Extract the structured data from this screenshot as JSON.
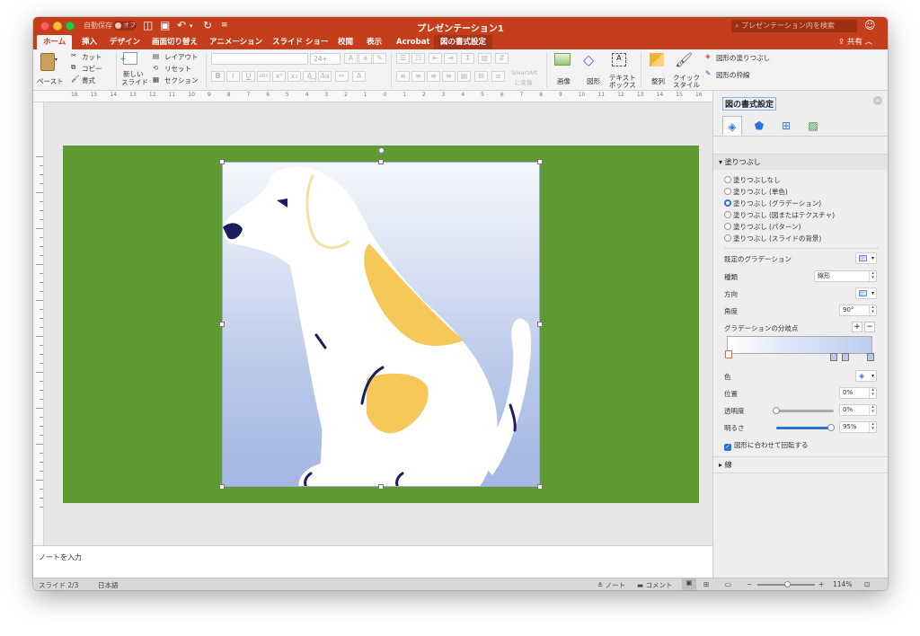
{
  "titlebar": {
    "autosave_label": "自動保存",
    "autosave_state": "オフ",
    "doc_title": "プレゼンテーション1",
    "search_placeholder": "プレゼンテーション内を検索"
  },
  "tabs": [
    {
      "label": "ホーム"
    },
    {
      "label": "挿入"
    },
    {
      "label": "デザイン"
    },
    {
      "label": "画面切り替え"
    },
    {
      "label": "アニメーション"
    },
    {
      "label": "スライド ショー"
    },
    {
      "label": "校閲"
    },
    {
      "label": "表示"
    },
    {
      "label": "Acrobat"
    },
    {
      "label": "図の書式設定"
    }
  ],
  "share_label": "共有",
  "ribbon": {
    "paste": "ペースト",
    "cut": "カット",
    "copy": "コピー",
    "format_painter": "書式",
    "new_slide_1": "新しい",
    "new_slide_2": "スライド",
    "layout": "レイアウト",
    "reset": "リセット",
    "section": "セクション",
    "font_size": "24+",
    "smartart_1": "SmartArt",
    "smartart_2": "に変換",
    "picture": "画像",
    "shapes": "図形",
    "textbox_1": "テキスト",
    "textbox_2": "ボックス",
    "arrange": "整列",
    "quick_style_1": "クイック",
    "quick_style_2": "スタイル",
    "shape_fill": "図形の塗りつぶし",
    "shape_outline": "図形の枠線"
  },
  "ruler": {
    "numbers": [
      "16",
      "15",
      "14",
      "13",
      "12",
      "11",
      "10",
      "9",
      "8",
      "7",
      "6",
      "5",
      "4",
      "3",
      "2",
      "1",
      "0",
      "1",
      "2",
      "3",
      "4",
      "5",
      "6",
      "7",
      "8",
      "9",
      "10",
      "11",
      "12",
      "13",
      "14",
      "15",
      "16"
    ]
  },
  "notes_placeholder": "ノートを入力",
  "status": {
    "slide": "スライド 2/3",
    "language": "日本語",
    "notes": "ノート",
    "comments": "コメント",
    "zoom": "114%"
  },
  "pane": {
    "title": "図の書式設定",
    "fill_section": "塗りつぶし",
    "fill_options": [
      {
        "label": "塗りつぶしなし",
        "selected": false
      },
      {
        "label": "塗りつぶし (単色)",
        "selected": false
      },
      {
        "label": "塗りつぶし (グラデーション)",
        "selected": true
      },
      {
        "label": "塗りつぶし (図またはテクスチャ)",
        "selected": false
      },
      {
        "label": "塗りつぶし (パターン)",
        "selected": false
      },
      {
        "label": "塗りつぶし (スライドの背景)",
        "selected": false
      }
    ],
    "preset_label": "既定のグラデーション",
    "type_label": "種類",
    "type_value": "線形",
    "direction_label": "方向",
    "angle_label": "角度",
    "angle_value": "90°",
    "stops_label": "グラデーションの分岐点",
    "color_label": "色",
    "position_label": "位置",
    "position_value": "0%",
    "transparency_label": "透明度",
    "transparency_value": "0%",
    "transparency_level": 0.0,
    "brightness_label": "明るさ",
    "brightness_value": "95%",
    "brightness_level": 0.95,
    "rotate_with_shape": "図形に合わせて回転する",
    "line_section": "線"
  },
  "colors": {
    "accent": "#c43e1c",
    "slide_background": "#5f9b32",
    "dog_body": "#ffffff",
    "dog_patch": "#f6c85a",
    "dog_detail": "#1c1d5a",
    "gradient_top": "#f5f7fc",
    "gradient_bottom": "#a4b6e2"
  }
}
